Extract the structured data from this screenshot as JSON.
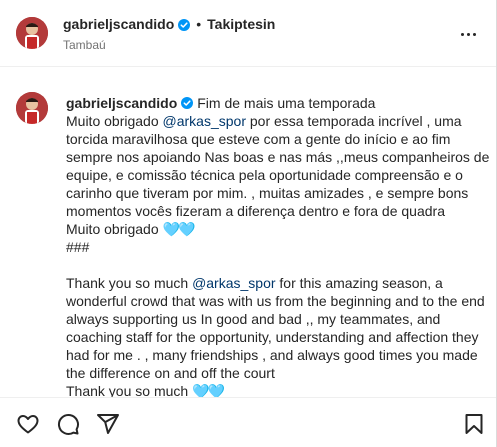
{
  "post": {
    "username": "gabrieljscandido",
    "follow_status": "Takiptesin",
    "separator": "•",
    "location": "Tambaú"
  },
  "caption": {
    "username": "gabrieljscandido",
    "line1": "Fim de mais uma temporada",
    "pt_before_mention": "Muito obrigado ",
    "mention": "@arkas_spor",
    "pt_after_mention": " por essa temporada incrível , uma torcida maravilhosa que esteve com a gente do início e ao fim sempre nos apoiando Nas boas e nas más ,,meus companheiros de equipe, e comissão técnica pela oportunidade compreensão e o carinho que tiveram por mim. , muitas amizades , e sempre bons momentos vocês fizeram a diferença dentro e fora de quadra",
    "pt_thanks": "Muito obrigado ",
    "hearts": "🩵🩵",
    "separator": "###",
    "en_before_mention": "Thank you so much ",
    "en_after_mention": " for this amazing season, a wonderful crowd that was with us from the beginning and to the end always supporting us In good and bad ,, my teammates, and coaching staff for the opportunity, understanding and affection they had for me . , many friendships , and always good times you made the difference on and off the court",
    "en_thanks": "Thank you so much "
  },
  "icons": {
    "more": "more-options-icon",
    "like": "heart-icon",
    "comment": "comment-icon",
    "share": "share-icon",
    "save": "bookmark-icon",
    "verified": "verified-badge-icon"
  },
  "colors": {
    "verified": "#0095f6",
    "mention": "#00376b",
    "hearts": "#00b5c2",
    "secondary_text": "#737373"
  }
}
